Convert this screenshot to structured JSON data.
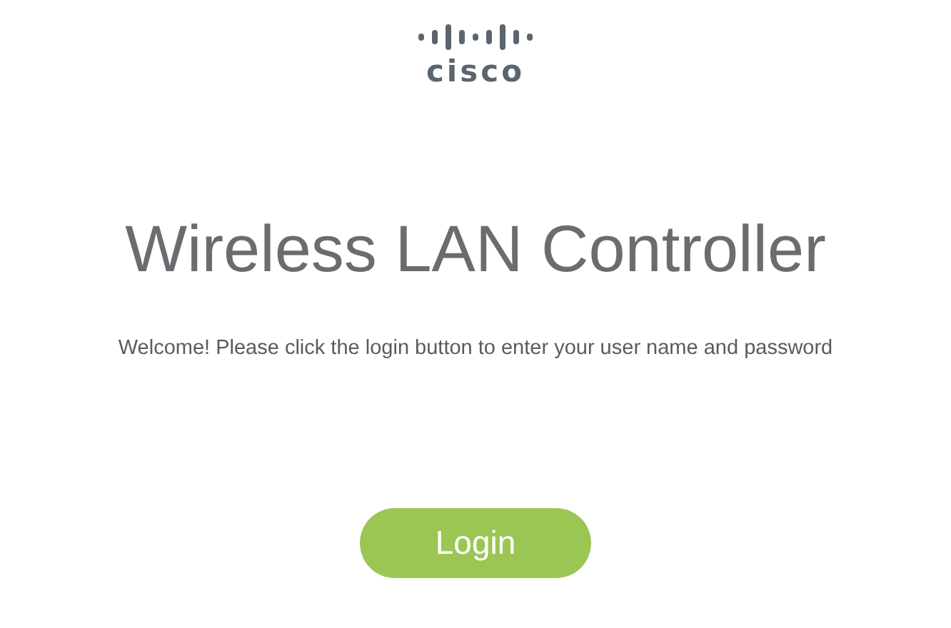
{
  "logo": {
    "wordmark": "cisco"
  },
  "title": "Wireless LAN Controller",
  "message": "Welcome! Please click the login button to enter your user name and password",
  "login_button": {
    "label": "Login"
  }
}
